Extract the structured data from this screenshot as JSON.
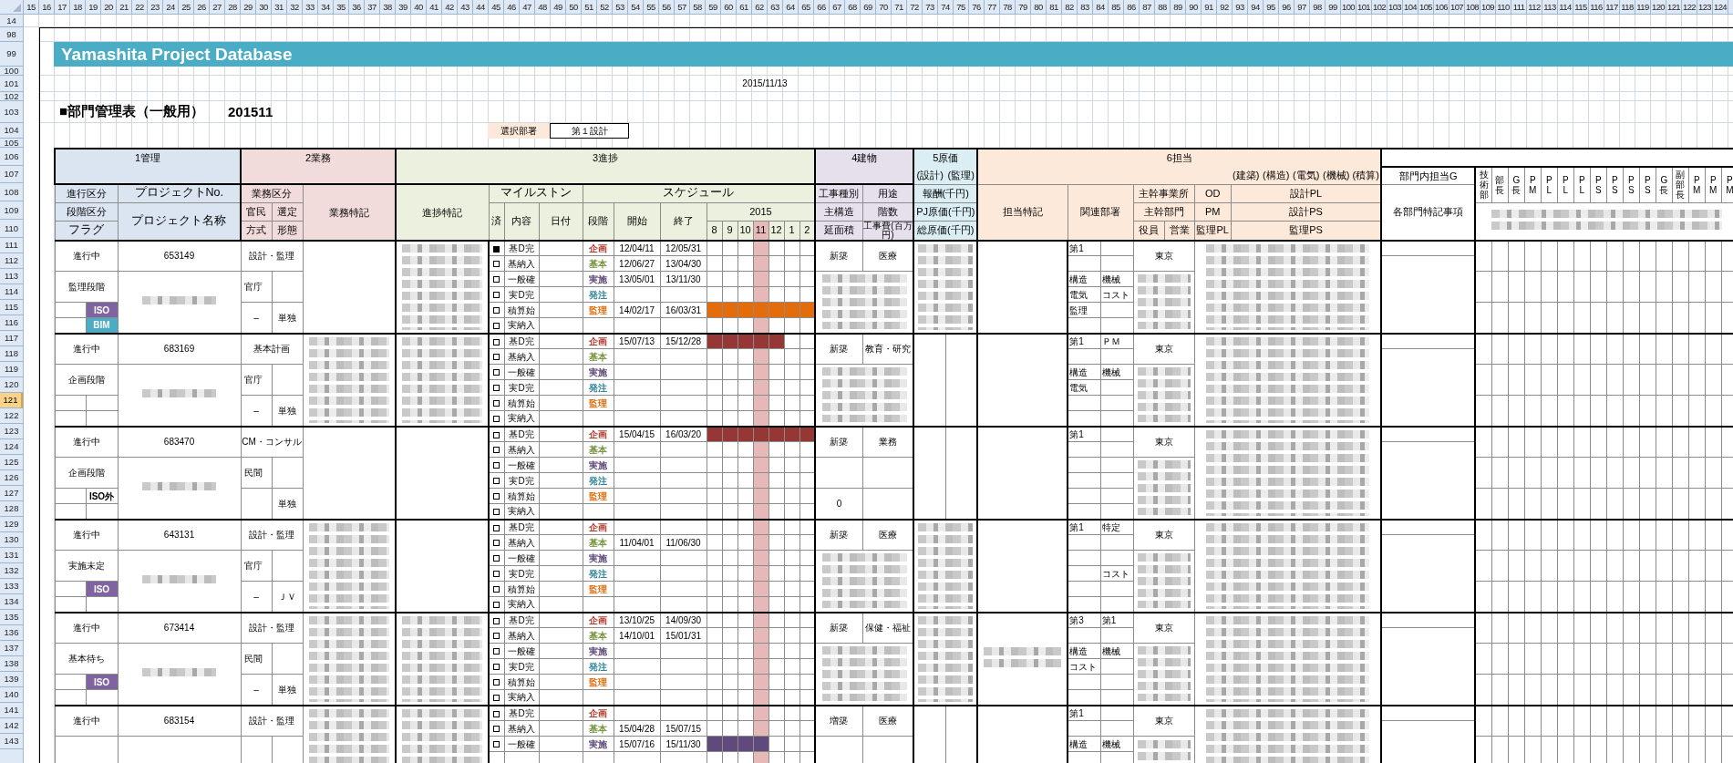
{
  "column_headers": [
    "15",
    "16",
    "17",
    "18",
    "19",
    "20",
    "21",
    "22",
    "23",
    "24",
    "25",
    "26",
    "27",
    "28",
    "29",
    "30",
    "31",
    "32",
    "33",
    "34",
    "35",
    "36",
    "37",
    "38",
    "39",
    "40",
    "41",
    "42",
    "43",
    "44",
    "45",
    "46",
    "47",
    "48",
    "49",
    "50",
    "51",
    "52",
    "53",
    "54",
    "55",
    "56",
    "57",
    "58",
    "59",
    "60",
    "61",
    "62",
    "63",
    "64",
    "65",
    "66",
    "67",
    "68",
    "69",
    "70",
    "71",
    "72",
    "73",
    "74",
    "75",
    "76",
    "77",
    "78",
    "79",
    "80",
    "81",
    "82",
    "83",
    "84",
    "85",
    "86",
    "87",
    "88",
    "89",
    "90",
    "91",
    "92",
    "93",
    "94",
    "95",
    "96",
    "97",
    "98",
    "99",
    "100",
    "101",
    "102",
    "103",
    "104",
    "105",
    "106",
    "107",
    "108",
    "109",
    "110",
    "111",
    "112",
    "113",
    "114",
    "115",
    "116",
    "117",
    "118",
    "119",
    "120",
    "121",
    "122",
    "123",
    "124"
  ],
  "row_headers": [
    {
      "label": "14",
      "selected": false
    },
    {
      "label": "98",
      "selected": false
    },
    {
      "label": "99",
      "selected": false
    },
    {
      "label": "100",
      "selected": false
    },
    {
      "label": "101",
      "selected": false
    },
    {
      "label": "102",
      "selected": false
    },
    {
      "label": "103",
      "selected": false
    },
    {
      "label": "104",
      "selected": false
    },
    {
      "label": "105",
      "selected": false
    },
    {
      "label": "106",
      "selected": false
    },
    {
      "label": "107",
      "selected": false
    },
    {
      "label": "108",
      "selected": false
    },
    {
      "label": "109",
      "selected": false
    },
    {
      "label": "110",
      "selected": false
    },
    {
      "label": "111",
      "selected": false
    },
    {
      "label": "112",
      "selected": false
    },
    {
      "label": "113",
      "selected": false
    },
    {
      "label": "114",
      "selected": false
    },
    {
      "label": "115",
      "selected": false
    },
    {
      "label": "116",
      "selected": false
    },
    {
      "label": "117",
      "selected": false
    },
    {
      "label": "118",
      "selected": false
    },
    {
      "label": "119",
      "selected": false
    },
    {
      "label": "120",
      "selected": false
    },
    {
      "label": "121",
      "selected": true
    },
    {
      "label": "122",
      "selected": false
    },
    {
      "label": "123",
      "selected": false
    },
    {
      "label": "124",
      "selected": false
    },
    {
      "label": "125",
      "selected": false
    },
    {
      "label": "126",
      "selected": false
    },
    {
      "label": "127",
      "selected": false
    },
    {
      "label": "128",
      "selected": false
    },
    {
      "label": "129",
      "selected": false
    },
    {
      "label": "130",
      "selected": false
    },
    {
      "label": "131",
      "selected": false
    },
    {
      "label": "132",
      "selected": false
    },
    {
      "label": "133",
      "selected": false
    },
    {
      "label": "134",
      "selected": false
    },
    {
      "label": "135",
      "selected": false
    },
    {
      "label": "136",
      "selected": false
    },
    {
      "label": "137",
      "selected": false
    },
    {
      "label": "138",
      "selected": false
    },
    {
      "label": "139",
      "selected": false
    },
    {
      "label": "140",
      "selected": false
    },
    {
      "label": "141",
      "selected": false
    },
    {
      "label": "142",
      "selected": false
    },
    {
      "label": "143",
      "selected": false
    }
  ],
  "title": "Yamashita Project Database",
  "date": "2015/11/13",
  "heading": {
    "title": "■部門管理表（一般用）",
    "period": "201511"
  },
  "department_selector": {
    "label": "選択部署",
    "value": "第１設計"
  },
  "header": {
    "sections": {
      "management": "1管理",
      "business": "2業務",
      "progress": "3進捗",
      "building": "4建物",
      "cost": "5原価",
      "staff": "6担当"
    },
    "cost_subtitles": [
      "(設計)",
      "(監理)"
    ],
    "staff_subtitles": [
      "(建築)",
      "(構造)",
      "(電気)",
      "(機械)",
      "(積算)"
    ],
    "columns": {
      "status": "進行区分",
      "stage": "段階区分",
      "flag": "フラグ",
      "project_no": "プロジェクトNo.",
      "project_name": "プロジェクト名称",
      "business_type": "業務区分",
      "sector": "官民",
      "selection": "選定",
      "method": "方式",
      "form": "形態",
      "business_notes": "業務特記",
      "progress_notes": "進捗特記",
      "milestone": "マイルストン",
      "done": "済",
      "content": "内容",
      "date": "日付",
      "schedule": "スケジュール",
      "phase": "段階",
      "start": "開始",
      "end": "終了",
      "year": "2015",
      "construction_type": "工事種別",
      "use": "用途",
      "structure": "主構造",
      "floors": "階数",
      "floor_area": "延面積",
      "construction_cost": "工事費(百万円)",
      "fee": "報酬(千円)",
      "pj_cost": "PJ原価(千円)",
      "total_cost": "総原価(千円)",
      "staff_notes": "担当特記",
      "related_departments": "関連部署",
      "main_office": "主幹事業所",
      "main_department": "主幹部門",
      "officer": "役員",
      "sales": "営業",
      "od": "OD",
      "pm": "PM",
      "supervision_pl": "監理PL",
      "design_pl": "設計PL",
      "design_ps": "設計PS",
      "supervision_ps": "監理PS",
      "department_group": "部門内担当G",
      "department_notes": "各部門特記事項"
    },
    "months": [
      {
        "label": "8",
        "current": false
      },
      {
        "label": "9",
        "current": false
      },
      {
        "label": "10",
        "current": false
      },
      {
        "label": "11",
        "current": true
      },
      {
        "label": "12",
        "current": false
      },
      {
        "label": "1",
        "current": false
      },
      {
        "label": "2",
        "current": false
      }
    ],
    "role_columns": [
      "技術部",
      "部長",
      "G長",
      "PM",
      "PL",
      "PL",
      "PL",
      "PS",
      "PS",
      "PS",
      "PS",
      "G長",
      "副部長",
      "PM",
      "PM",
      "PM"
    ]
  },
  "projects": [
    {
      "status": "進行中",
      "number": "653149",
      "stage": "監理段階",
      "flags": [
        {
          "label": "ISO",
          "color": "#8064a2"
        },
        {
          "label": "BIM",
          "color": "#4bacc6"
        }
      ],
      "name_blurred": true,
      "business_type": "設計・監理",
      "sector": "官庁",
      "method": "–",
      "form": "単独",
      "business_notes_blurred": false,
      "progress_notes_blurred": true,
      "milestones": [
        {
          "label": "基D完",
          "done": true
        },
        {
          "label": "基納入",
          "done": false
        },
        {
          "label": "一般確",
          "done": false
        },
        {
          "label": "実D完",
          "done": false
        },
        {
          "label": "積算始",
          "done": false
        },
        {
          "label": "実納入",
          "done": false
        }
      ],
      "phases": [
        {
          "label": "企画",
          "color": "#b03a2e",
          "start": "12/04/11",
          "end": "12/05/31"
        },
        {
          "label": "基本",
          "color": "#76933c",
          "start": "12/06/27",
          "end": "13/04/30"
        },
        {
          "label": "実施",
          "color": "#604a7b",
          "start": "13/05/01",
          "end": "13/11/30"
        },
        {
          "label": "発注",
          "color": "#31859c"
        },
        {
          "label": "監理",
          "color": "#e46c0a",
          "start": "14/02/17",
          "end": "16/03/31",
          "bar": {
            "color": "#e46c0a",
            "cells": [
              true,
              true,
              true,
              true,
              true,
              true,
              true
            ]
          }
        }
      ],
      "construction_type": "新築",
      "use": "医療",
      "building_blurred": true,
      "cost_blurred": true,
      "staff_notes_blurred": false,
      "departments": {
        "line_1": {
          "primary": "第1"
        },
        "line_3": {
          "primary": "構造",
          "secondary": "機械"
        },
        "line_4": {
          "primary": "電気",
          "secondary": "コスト"
        },
        "line_5": {
          "primary": "監理"
        }
      },
      "office": "東京",
      "staff_blurred": true
    },
    {
      "status": "進行中",
      "number": "683169",
      "stage": "企画段階",
      "name_blurred": true,
      "business_type": "基本計画",
      "sector": "官庁",
      "method": "–",
      "form": "単独",
      "business_notes_blurred": true,
      "progress_notes_blurred": true,
      "milestones": [
        {
          "label": "基D完",
          "done": false
        },
        {
          "label": "基納入",
          "done": false
        },
        {
          "label": "一般確",
          "done": false
        },
        {
          "label": "実D完",
          "done": false
        },
        {
          "label": "積算始",
          "done": false
        },
        {
          "label": "実納入",
          "done": false
        }
      ],
      "phases": [
        {
          "label": "企画",
          "color": "#b03a2e",
          "start": "15/07/13",
          "end": "15/12/28",
          "bar": {
            "color": "#953735",
            "cells": [
              true,
              true,
              true,
              true,
              true,
              false,
              false
            ]
          }
        },
        {
          "label": "基本",
          "color": "#76933c"
        },
        {
          "label": "実施",
          "color": "#604a7b"
        },
        {
          "label": "発注",
          "color": "#31859c"
        },
        {
          "label": "監理",
          "color": "#e46c0a"
        }
      ],
      "construction_type": "新築",
      "use": "教育・研究",
      "building_blurred": true,
      "cost_blurred": false,
      "staff_notes_blurred": false,
      "departments": {
        "line_1": {
          "primary": "第1",
          "secondary": "ＰＭ"
        },
        "line_3": {
          "primary": "構造",
          "secondary": "機械"
        },
        "line_4": {
          "primary": "電気"
        }
      },
      "office": "東京",
      "staff_blurred": true
    },
    {
      "status": "進行中",
      "number": "683470",
      "stage": "企画段階",
      "flags": [
        {
          "label": "ISO外"
        }
      ],
      "name_blurred": true,
      "business_type": "CM・コンサル",
      "sector": "民間",
      "form": "単独",
      "business_notes_blurred": false,
      "progress_notes_blurred": false,
      "milestones": [
        {
          "label": "基D完",
          "done": false
        },
        {
          "label": "基納入",
          "done": false
        },
        {
          "label": "一般確",
          "done": false
        },
        {
          "label": "実D完",
          "done": false
        },
        {
          "label": "積算始",
          "done": false
        },
        {
          "label": "実納入",
          "done": false
        }
      ],
      "phases": [
        {
          "label": "企画",
          "color": "#b03a2e",
          "start": "15/04/15",
          "end": "16/03/20",
          "bar": {
            "color": "#953735",
            "cells": [
              true,
              true,
              true,
              true,
              true,
              true,
              true
            ]
          }
        },
        {
          "label": "基本",
          "color": "#76933c"
        },
        {
          "label": "実施",
          "color": "#604a7b"
        },
        {
          "label": "発注",
          "color": "#31859c"
        },
        {
          "label": "監理",
          "color": "#e46c0a"
        }
      ],
      "construction_type": "新築",
      "use": "業務",
      "building_blurred": false,
      "floor_area": "0",
      "cost_blurred": false,
      "staff_notes_blurred": false,
      "departments": {
        "line_1": {
          "primary": "第1"
        }
      },
      "office": "東京",
      "staff_blurred": true
    },
    {
      "status": "進行中",
      "number": "643131",
      "stage": "実施未定",
      "flags": [
        {
          "label": "ISO",
          "color": "#8064a2"
        }
      ],
      "name_blurred": true,
      "business_type": "設計・監理",
      "sector": "官庁",
      "method": "–",
      "form": "ＪＶ",
      "business_notes_blurred": true,
      "progress_notes_blurred": false,
      "milestones": [
        {
          "label": "基D完",
          "done": false
        },
        {
          "label": "基納入",
          "done": false
        },
        {
          "label": "一般確",
          "done": false
        },
        {
          "label": "実D完",
          "done": false
        },
        {
          "label": "積算始",
          "done": false
        },
        {
          "label": "実納入",
          "done": false
        }
      ],
      "phases": [
        {
          "label": "企画",
          "color": "#b03a2e"
        },
        {
          "label": "基本",
          "color": "#76933c",
          "start": "11/04/01",
          "end": "11/06/30"
        },
        {
          "label": "実施",
          "color": "#604a7b"
        },
        {
          "label": "発注",
          "color": "#31859c"
        },
        {
          "label": "監理",
          "color": "#e46c0a"
        }
      ],
      "construction_type": "新築",
      "use": "医療",
      "building_blurred": true,
      "cost_blurred": true,
      "staff_notes_blurred": false,
      "departments": {
        "line_1": {
          "primary": "第1",
          "secondary": "特定"
        },
        "line_4": {
          "secondary": "コスト"
        }
      },
      "office": "東京",
      "staff_blurred": true
    },
    {
      "status": "進行中",
      "number": "673414",
      "stage": "基本待ち",
      "flags": [
        {
          "label": "ISO",
          "color": "#8064a2"
        }
      ],
      "name_blurred": true,
      "business_type": "設計・監理",
      "sector": "民間",
      "method": "–",
      "form": "単独",
      "business_notes_blurred": true,
      "progress_notes_blurred": true,
      "milestones": [
        {
          "label": "基D完",
          "done": false
        },
        {
          "label": "基納入",
          "done": false
        },
        {
          "label": "一般確",
          "done": false
        },
        {
          "label": "実D完",
          "done": false
        },
        {
          "label": "積算始",
          "done": false
        },
        {
          "label": "実納入",
          "done": false
        }
      ],
      "phases": [
        {
          "label": "企画",
          "color": "#b03a2e",
          "start": "13/10/25",
          "end": "14/09/30"
        },
        {
          "label": "基本",
          "color": "#76933c",
          "start": "14/10/01",
          "end": "15/01/31"
        },
        {
          "label": "実施",
          "color": "#604a7b"
        },
        {
          "label": "発注",
          "color": "#31859c"
        },
        {
          "label": "監理",
          "color": "#e46c0a"
        }
      ],
      "construction_type": "新築",
      "use": "保健・福祉",
      "building_blurred": true,
      "cost_blurred": true,
      "staff_notes_blurred": true,
      "departments": {
        "line_1": {
          "primary": "第3",
          "secondary": "第1"
        },
        "line_3": {
          "primary": "構造",
          "secondary": "機械"
        },
        "line_4": {
          "primary": "コスト"
        }
      },
      "office": "東京",
      "staff_blurred": true
    },
    {
      "status": "進行中",
      "number": "683154",
      "business_type": "設計・監理",
      "business_notes_blurred": true,
      "progress_notes_blurred": true,
      "milestones": [
        {
          "label": "基D完",
          "done": false
        },
        {
          "label": "基納入",
          "done": false
        },
        {
          "label": "一般確",
          "done": false
        }
      ],
      "phases": [
        {
          "label": "企画",
          "color": "#b03a2e"
        },
        {
          "label": "基本",
          "color": "#76933c",
          "start": "15/04/28",
          "end": "15/07/15"
        },
        {
          "label": "実施",
          "color": "#604a7b",
          "start": "15/07/16",
          "end": "15/11/30",
          "bar": {
            "color": "#604a7b",
            "cells": [
              true,
              true,
              true,
              true,
              false,
              false,
              false
            ]
          }
        }
      ],
      "construction_type": "増築",
      "use": "医療",
      "building_blurred": false,
      "cost_blurred": false,
      "staff_notes_blurred": false,
      "departments": {
        "line_1": {
          "primary": "第1"
        },
        "line_3": {
          "primary": "構造",
          "secondary": "機械"
        }
      },
      "office": "東京",
      "staff_blurred": true
    }
  ]
}
